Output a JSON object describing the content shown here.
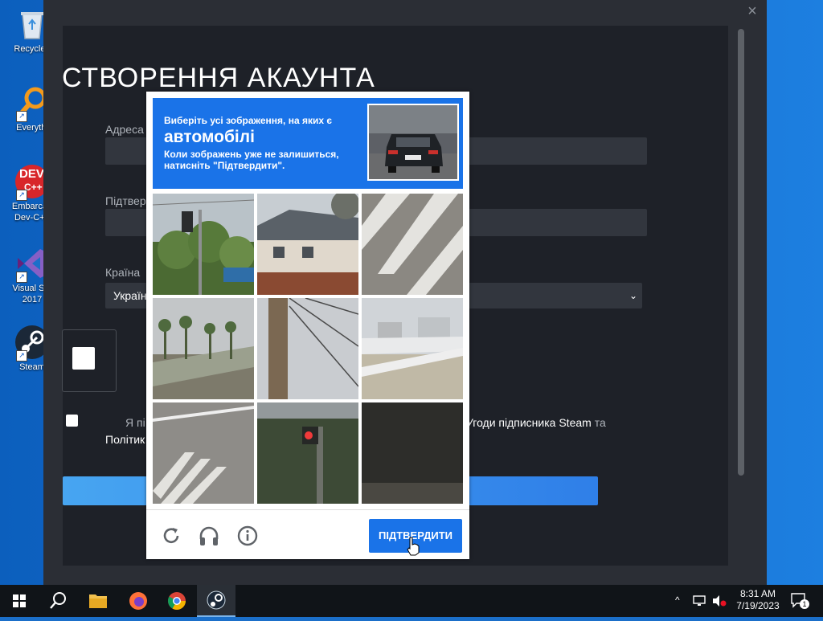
{
  "desktop": {
    "icons": [
      {
        "label": "Recycle Bin",
        "visible": "Recycle I"
      },
      {
        "label": "Everything",
        "visible": "Everythi"
      },
      {
        "label_line1": "Embarcad",
        "label_line2": "Dev-C++"
      },
      {
        "label_line1": "Visual Stu",
        "label_line2": "2017"
      },
      {
        "label": "Steam"
      }
    ],
    "devcpp_logo_top": "DEV",
    "devcpp_logo_bottom": "C++"
  },
  "window": {
    "close_glyph": "×",
    "title": "СТВОРЕННЯ АКАУНТА",
    "email_label": "Адреса",
    "confirm_label": "Підтвер",
    "country_label": "Країна",
    "country_value": "Україна",
    "country_chevron": "⌄",
    "agree_prefix": "Я пі",
    "agree_link": "Угоди підписника Steam",
    "agree_and": "та",
    "agree_line2": "Політик"
  },
  "captcha": {
    "instruction_top": "Виберіть усі зображення, на яких є",
    "target": "автомобілі",
    "instruction_bottom": "Коли зображень уже не залишиться, натисніть \"Підтвердити\".",
    "verify_label": "ПІДТВЕРДИТИ",
    "tiles": [
      {
        "name": "traffic-light-trees"
      },
      {
        "name": "house-with-fence"
      },
      {
        "name": "crosswalk-stripes"
      },
      {
        "name": "palm-trees-road"
      },
      {
        "name": "utility-pole-wires"
      },
      {
        "name": "overpass-bridge"
      },
      {
        "name": "road-crosswalk"
      },
      {
        "name": "red-traffic-light"
      },
      {
        "name": "dark-noise"
      }
    ],
    "icons": [
      "reload-icon",
      "headphones-icon",
      "info-icon"
    ]
  },
  "taskbar": {
    "time": "8:31 AM",
    "date": "7/19/2023",
    "notification_count": "1",
    "chevron": "^"
  },
  "colors": {
    "captcha_blue": "#1a73e8",
    "steam_bg": "#1e2128",
    "continue_gradient": [
      "#47a5f1",
      "#2f7fe8"
    ]
  }
}
